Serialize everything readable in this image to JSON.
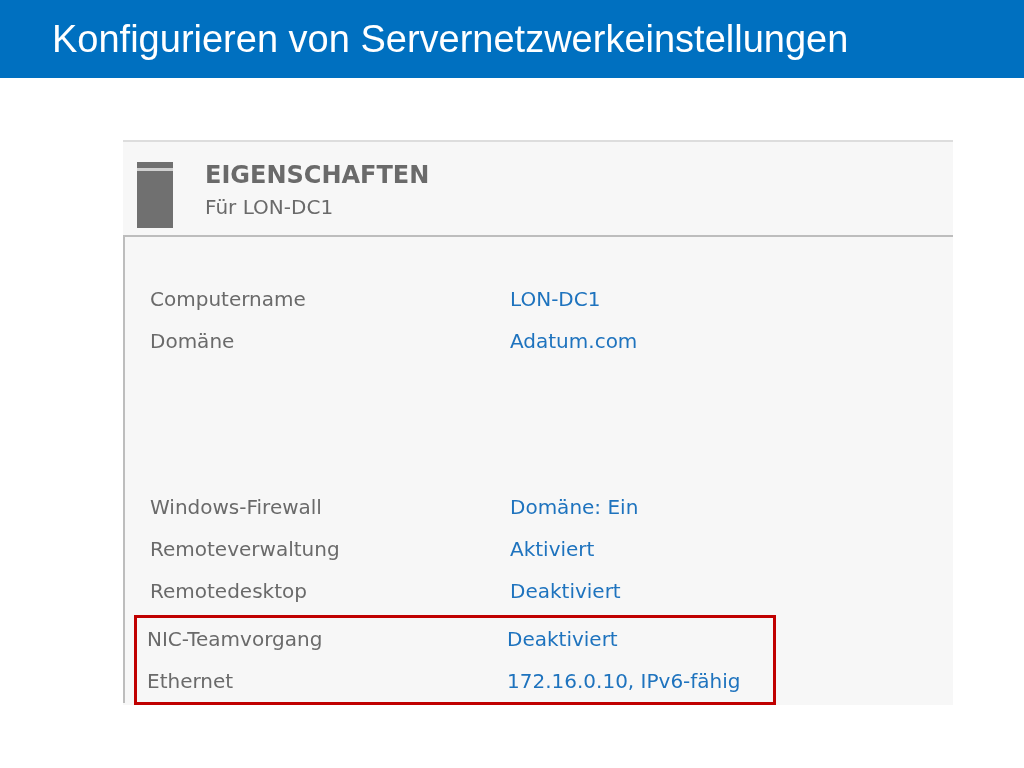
{
  "slide_title": "Konfigurieren von Servernetzwerkeinstellungen",
  "panel": {
    "title": "EIGENSCHAFTEN",
    "subtitle": "Für LON-DC1",
    "groups": [
      {
        "highlighted": false,
        "rows": [
          {
            "label": "Computername",
            "value": "LON-DC1"
          },
          {
            "label": "Domäne",
            "value": "Adatum.com"
          }
        ]
      },
      {
        "highlighted": false,
        "rows": [
          {
            "label": "Windows-Firewall",
            "value": "Domäne: Ein"
          },
          {
            "label": "Remoteverwaltung",
            "value": "Aktiviert"
          },
          {
            "label": "Remotedesktop",
            "value": "Deaktiviert"
          }
        ]
      },
      {
        "highlighted": true,
        "rows": [
          {
            "label": "NIC-Teamvorgang",
            "value": "Deaktiviert"
          },
          {
            "label": "Ethernet",
            "value": "172.16.0.10, IPv6-fähig"
          }
        ]
      }
    ]
  }
}
